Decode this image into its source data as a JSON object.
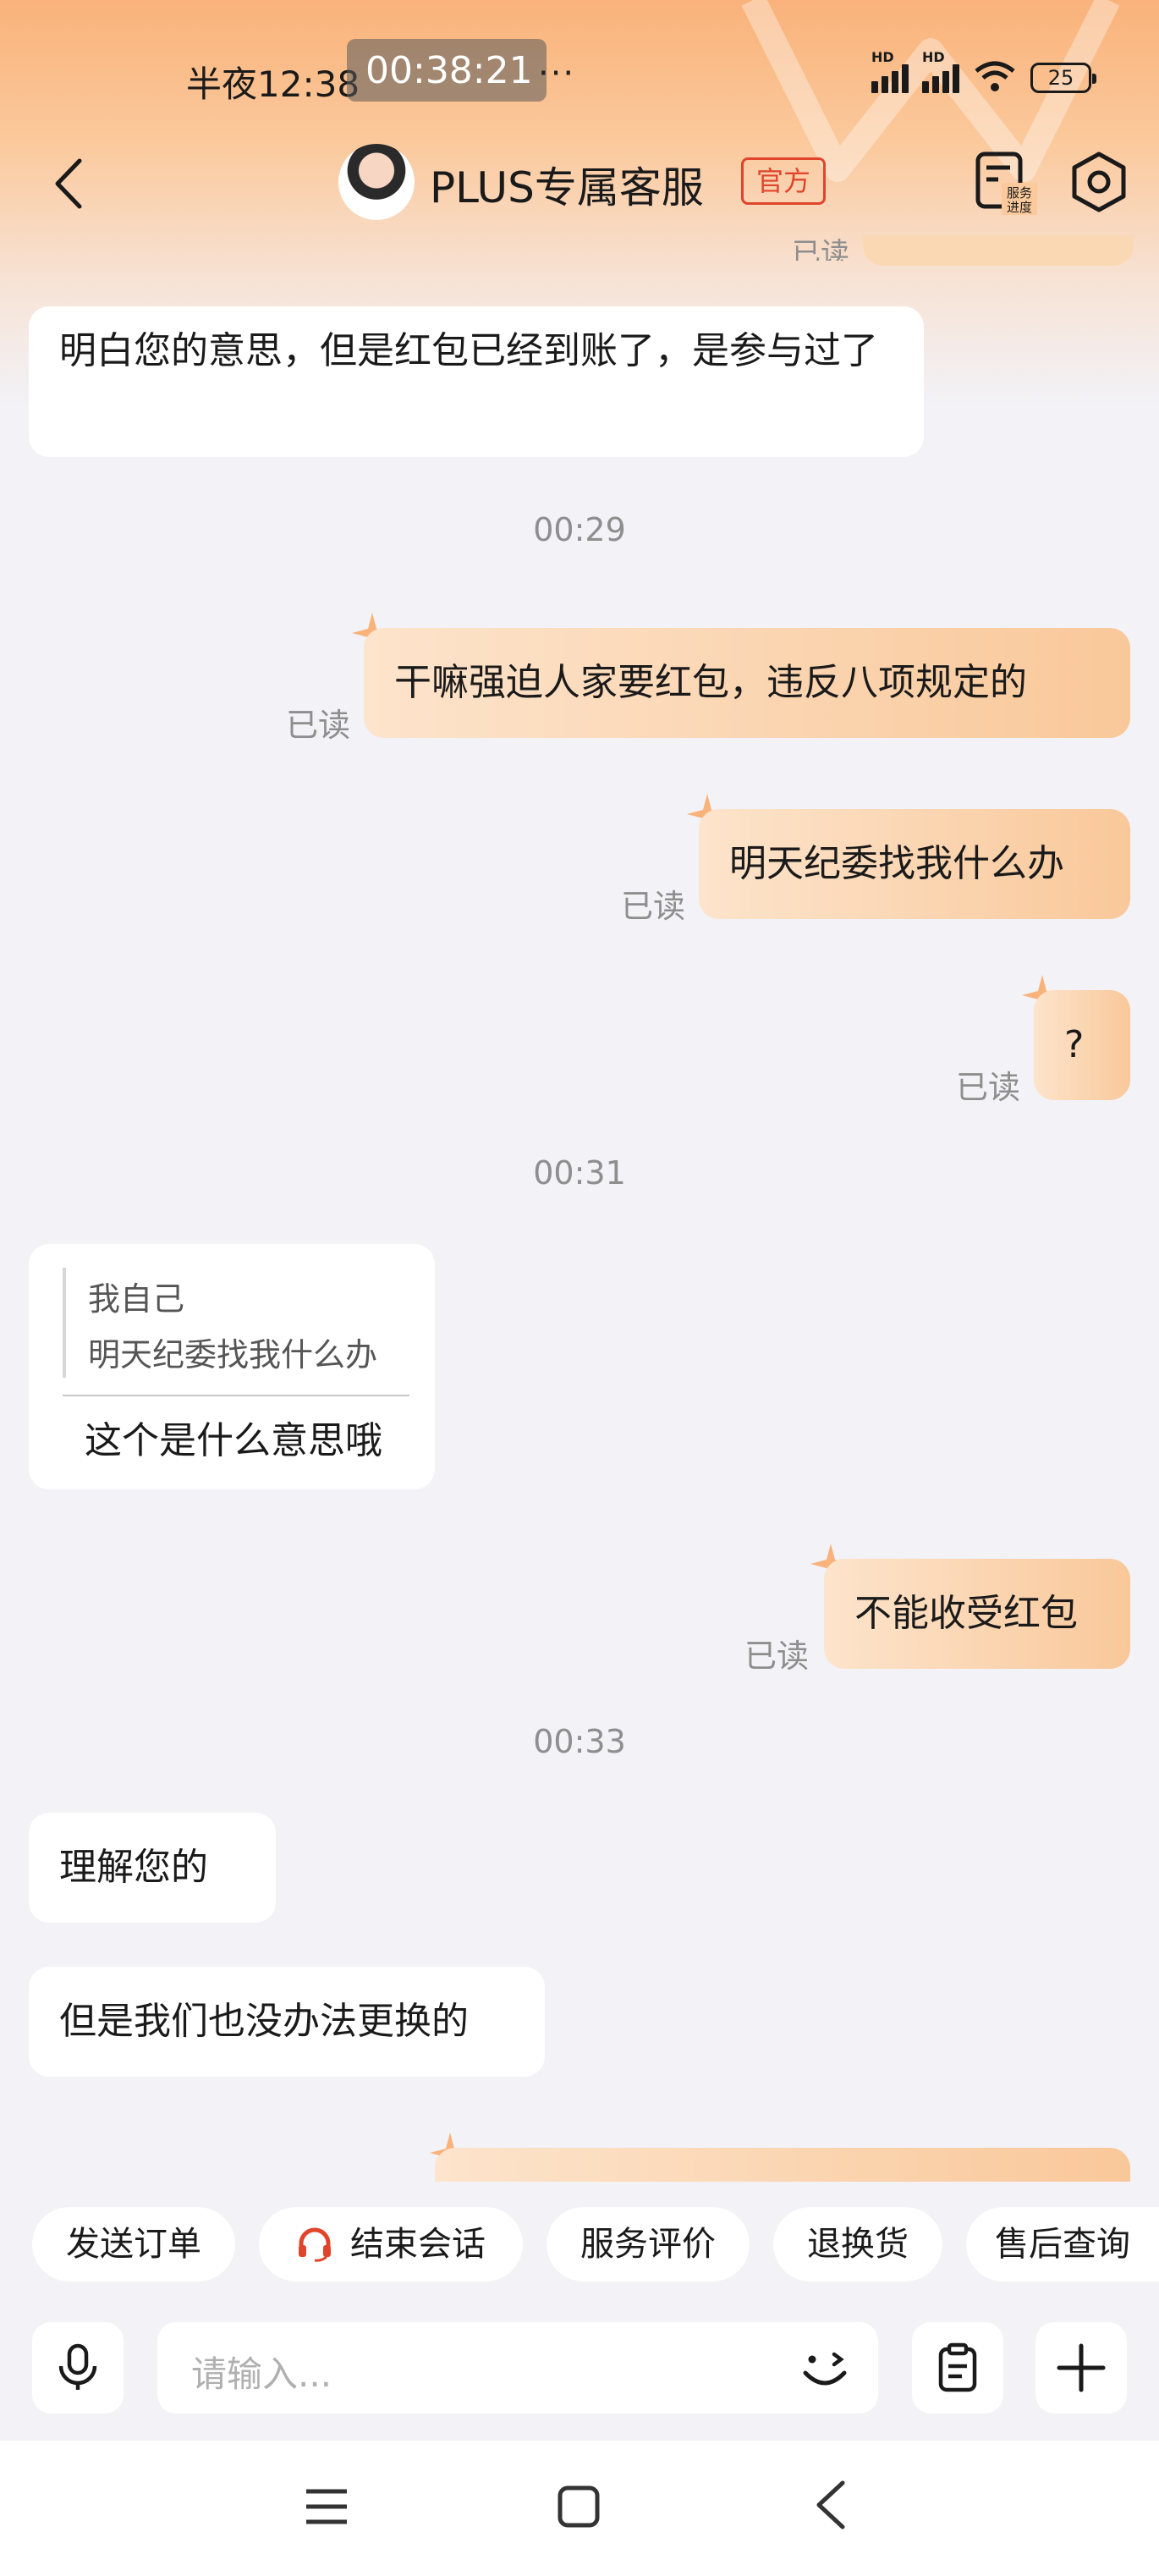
{
  "status_bar": {
    "time": "半夜12:38",
    "recording_time": "00:38:21",
    "more": "···",
    "signal_label": "HD",
    "battery": "25"
  },
  "header": {
    "title": "PLUS专属客服",
    "badge": "官方",
    "progress_icon_label": "服务进度"
  },
  "messages": {
    "prev_read": "已读",
    "m1": "明白您的意思，但是红包已经到账了，是参与过了",
    "t1": "00:29",
    "m2": "干嘛强迫人家要红包，违反八项规定的",
    "m2_status": "已读",
    "m3": "明天纪委找我什么办",
    "m3_status": "已读",
    "m4": "?",
    "m4_status": "已读",
    "t2": "00:31",
    "quote": {
      "author": "我自己",
      "quoted_text": "明天纪委找我什么办",
      "reply": "这个是什么意思哦"
    },
    "m5": "不能收受红包",
    "m5_status": "已读",
    "t3": "00:33",
    "m6": "理解您的",
    "m7": "但是我们也没办法更换的"
  },
  "quick_actions": [
    {
      "label": "发送订单"
    },
    {
      "label": "结束会话",
      "icon": "headset-icon"
    },
    {
      "label": "服务评价"
    },
    {
      "label": "退换货"
    },
    {
      "label": "售后查询"
    }
  ],
  "input": {
    "placeholder": "请输入..."
  },
  "colors": {
    "accent": "#f9b27a",
    "outgoing_bubble": "#f9c89a",
    "official_badge": "#e0452c",
    "headset": "#e0452c"
  }
}
